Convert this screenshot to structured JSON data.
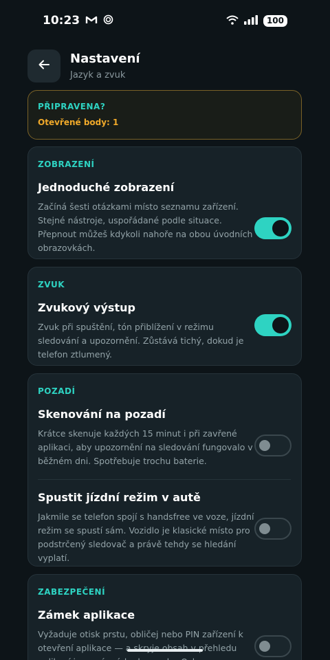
{
  "status_bar": {
    "time": "10:23",
    "icons": [
      "gmail-icon",
      "sync-icon",
      "wifi-icon",
      "signal-icon"
    ],
    "battery": "100"
  },
  "header": {
    "title": "Nastavení",
    "subtitle": "Jazyk a zvuk"
  },
  "ready_card": {
    "title": "PŘIPRAVENA?",
    "subtitle": "Otevřené body: 1"
  },
  "sections": {
    "display": {
      "label": "ZOBRAZENÍ",
      "items": [
        {
          "title": "Jednoduché zobrazení",
          "description": "Začíná šesti otázkami místo seznamu zařízení. Stejné nástroje, uspořádané podle situace. Přepnout můžeš kdykoli nahoře na obou úvodních obrazovkách.",
          "enabled": true
        }
      ]
    },
    "sound": {
      "label": "ZVUK",
      "items": [
        {
          "title": "Zvukový výstup",
          "description": "Zvuk při spuštění, tón přiblížení v režimu sledování a upozornění. Zůstává tichý, dokud je telefon ztlumený.",
          "enabled": true
        }
      ]
    },
    "background": {
      "label": "POZADÍ",
      "items": [
        {
          "title": "Skenování na pozadí",
          "description": "Krátce skenuje každých 15 minut i při zavřené aplikaci, aby upozornění na sledování fungovalo v běžném dni. Spotřebuje trochu baterie.",
          "enabled": false
        },
        {
          "title": "Spustit jízdní režim v autě",
          "description": "Jakmile se telefon spojí s handsfree ve voze, jízdní režim se spustí sám. Vozidlo je klasické místo pro podstrčený sledovač a právě tehdy se hledání vyplatí.",
          "enabled": false
        }
      ]
    },
    "security": {
      "label": "ZABEZPEČENÍ",
      "items": [
        {
          "title": "Zámek aplikace",
          "description": "Vyžaduje otisk prstu, obličej nebo PIN zařízení k otevření aplikace — a skryje obsah v přehledu aplikací i na snímcích obrazovky. Ochrana,",
          "enabled": false
        }
      ]
    }
  },
  "colors": {
    "accent": "#2ed3c2",
    "warning": "#f0a92a",
    "background": "#0d1418",
    "card": "#172228"
  }
}
